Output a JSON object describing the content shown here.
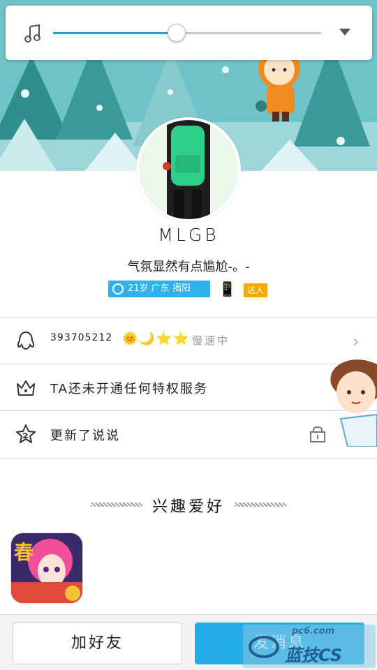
{
  "music": {
    "progress": 0.46,
    "note_icon": "music-note-icon",
    "expand_icon": "chevron-down-icon",
    "accent": "#1aa6e6"
  },
  "profile": {
    "name": "MLGB",
    "signature": "气氛显然有点尴尬-。-",
    "location_tag": "21岁 广东 揭阳",
    "star_tag": "达人"
  },
  "rows": [
    {
      "id": "qq",
      "number": "393705212",
      "level_icons": "🌞🌙⭐⭐",
      "speed": "慢速中"
    },
    {
      "id": "vip",
      "label": "TA还未开通任何特权服务"
    },
    {
      "id": "moments",
      "label": "更新了说说"
    }
  ],
  "hobbies": {
    "title": "兴趣爱好",
    "game_label": "春"
  },
  "buttons": {
    "add_friend": "加好友",
    "send_message": "发消息"
  },
  "watermark": {
    "top": "pc6.com",
    "bottom": "蓝技CS"
  },
  "colors": {
    "header_bg": "#6ec3c9",
    "button_blue": "#23aee8",
    "tag_blue": "#2fb1ec",
    "tag_gold": "#f7a800"
  }
}
